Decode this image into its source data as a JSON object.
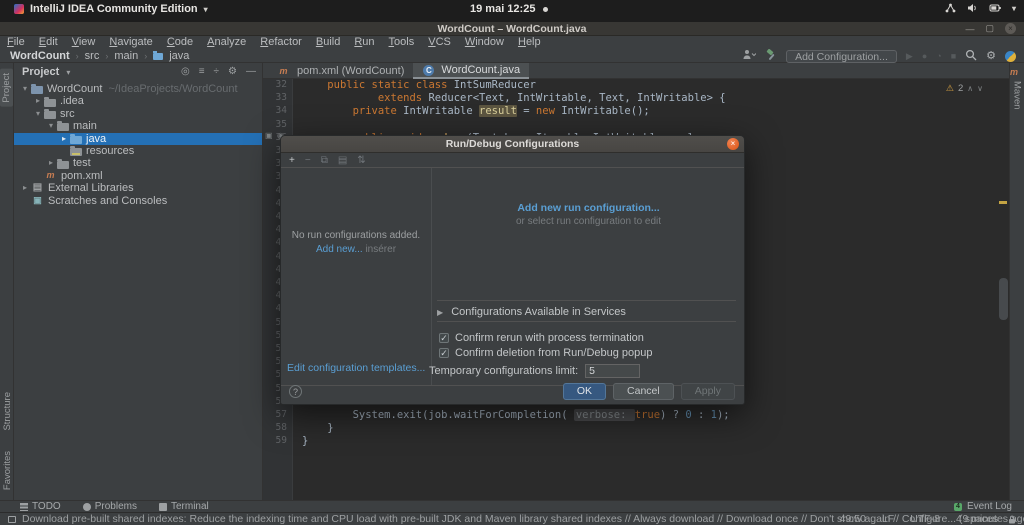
{
  "colors": {
    "accent_blue": "#2470b5",
    "link_blue": "#5a9fd4",
    "ubuntu_orange": "#dd5414",
    "warning_yellow": "#d9a343"
  },
  "system_bar": {
    "app_title": "IntelliJ IDEA Community Edition",
    "clock": "19 mai 12:25"
  },
  "window": {
    "title": "WordCount – WordCount.java"
  },
  "menu_bar": {
    "items": [
      "File",
      "Edit",
      "View",
      "Navigate",
      "Code",
      "Analyze",
      "Refactor",
      "Build",
      "Run",
      "Tools",
      "VCS",
      "Window",
      "Help"
    ]
  },
  "nav_bar": {
    "breadcrumbs": [
      {
        "label": "WordCount",
        "bold": true
      },
      {
        "label": "src"
      },
      {
        "label": "main"
      },
      {
        "label": "java",
        "icon": "folder"
      }
    ],
    "add_configuration": "Add Configuration..."
  },
  "tool_strips": {
    "left_top": "Project",
    "left_bottom": [
      "Structure",
      "Favorites"
    ],
    "right": "Maven"
  },
  "icons": {
    "maven-file": "m",
    "java-class": "C",
    "libraries": "▤",
    "scratches": "▣"
  },
  "project_panel": {
    "title": "Project",
    "tree": [
      {
        "depth": 0,
        "arrow": "expanded",
        "icon": "project-folder",
        "label": "WordCount",
        "hint": "~/IdeaProjects/WordCount"
      },
      {
        "depth": 1,
        "arrow": "collapsed",
        "icon": "folder",
        "label": ".idea"
      },
      {
        "depth": 1,
        "arrow": "expanded",
        "icon": "folder",
        "label": "src"
      },
      {
        "depth": 2,
        "arrow": "expanded",
        "icon": "folder",
        "label": "main"
      },
      {
        "depth": 3,
        "arrow": "collapsed",
        "icon": "source-folder",
        "label": "java",
        "selected": true
      },
      {
        "depth": 3,
        "arrow": "none",
        "icon": "resources-folder",
        "label": "resources"
      },
      {
        "depth": 2,
        "arrow": "collapsed",
        "icon": "folder",
        "label": "test"
      },
      {
        "depth": 1,
        "arrow": "none",
        "icon": "maven-file",
        "label": "pom.xml"
      },
      {
        "depth": 0,
        "arrow": "collapsed",
        "icon": "libraries",
        "label": "External Libraries"
      },
      {
        "depth": 0,
        "arrow": "none",
        "icon": "scratches",
        "label": "Scratches and Consoles"
      }
    ]
  },
  "editor": {
    "tabs": [
      {
        "icon": "maven-file",
        "label": "pom.xml (WordCount)",
        "active": false
      },
      {
        "icon": "java-class",
        "label": "WordCount.java",
        "active": true
      }
    ],
    "inspections": {
      "warnings": "2"
    },
    "gutter": {
      "start": 32,
      "end": 59
    },
    "code": [
      {
        "line": 32,
        "tokens": [
          {
            "t": "    ",
            "c": "pl"
          },
          {
            "t": "public static class ",
            "c": "k"
          },
          {
            "t": "IntSumReducer",
            "c": "pl"
          }
        ]
      },
      {
        "line": 33,
        "tokens": [
          {
            "t": "            ",
            "c": "pl"
          },
          {
            "t": "extends ",
            "c": "k"
          },
          {
            "t": "Reducer<Text, IntWritable, Text, IntWritable> {",
            "c": "pl"
          }
        ]
      },
      {
        "line": 34,
        "tokens": [
          {
            "t": "        ",
            "c": "pl"
          },
          {
            "t": "private ",
            "c": "k"
          },
          {
            "t": "IntWritable ",
            "c": "pl"
          },
          {
            "t": "result",
            "c": "hl"
          },
          {
            "t": " = ",
            "c": "pl"
          },
          {
            "t": "new ",
            "c": "k"
          },
          {
            "t": "IntWritable();",
            "c": "pl"
          }
        ]
      },
      {
        "line": 35,
        "tokens": []
      },
      {
        "line": 36,
        "tokens": [
          {
            "t": "        ",
            "c": "pl"
          },
          {
            "t": "public void ",
            "c": "k"
          },
          {
            "t": "reduce",
            "c": "m"
          },
          {
            "t": "(Text key, Iterable<IntWritable> values,",
            "c": "pl"
          }
        ]
      },
      {
        "line": 57,
        "tokens": [
          {
            "t": "        ",
            "c": "pl"
          },
          {
            "t": "System.exit(job.waitForCompletion( ",
            "c": "pl"
          },
          {
            "t": "verbose: ",
            "c": "hint"
          },
          {
            "t": "true",
            "c": "k"
          },
          {
            "t": ") ? ",
            "c": "pl"
          },
          {
            "t": "0",
            "c": "n"
          },
          {
            "t": " : ",
            "c": "pl"
          },
          {
            "t": "1",
            "c": "n"
          },
          {
            "t": ");",
            "c": "pl"
          }
        ]
      },
      {
        "line": 58,
        "tokens": [
          {
            "t": "    }",
            "c": "pl"
          }
        ]
      },
      {
        "line": 59,
        "tokens": [
          {
            "t": "}",
            "c": "pl"
          }
        ]
      }
    ]
  },
  "dialog": {
    "title": "Run/Debug Configurations",
    "left": {
      "empty_text": "No run configurations added.",
      "add_new": "Add new...",
      "add_new_shortcut": "insérer",
      "edit_templates": "Edit configuration templates...",
      "help": "?"
    },
    "right": {
      "add_link": "Add new run configuration...",
      "or_select": "or select run configuration to edit",
      "services": "Configurations Available in Services",
      "checkboxes": [
        {
          "label": "Confirm rerun with process termination",
          "checked": true
        },
        {
          "label": "Confirm deletion from Run/Debug popup",
          "checked": true
        }
      ],
      "limit_label": "Temporary configurations limit:",
      "limit_value": "5"
    },
    "buttons": {
      "ok": "OK",
      "cancel": "Cancel",
      "apply": "Apply"
    }
  },
  "bottom_bar": {
    "tools": [
      {
        "icon": "todo",
        "label": "TODO"
      },
      {
        "icon": "problems",
        "label": "Problems"
      },
      {
        "icon": "terminal",
        "label": "Terminal"
      }
    ],
    "event_log": "Event Log"
  },
  "status_bar": {
    "message": "Download pre-built shared indexes: Reduce the indexing time and CPU load with pre-built JDK and Maven library shared indexes // Always download // Download once // Don't show again // Configure... (9 minutes ago)",
    "caret": "49:50",
    "line_sep": "LF",
    "encoding": "UTF-8",
    "indent": "4 spaces"
  }
}
